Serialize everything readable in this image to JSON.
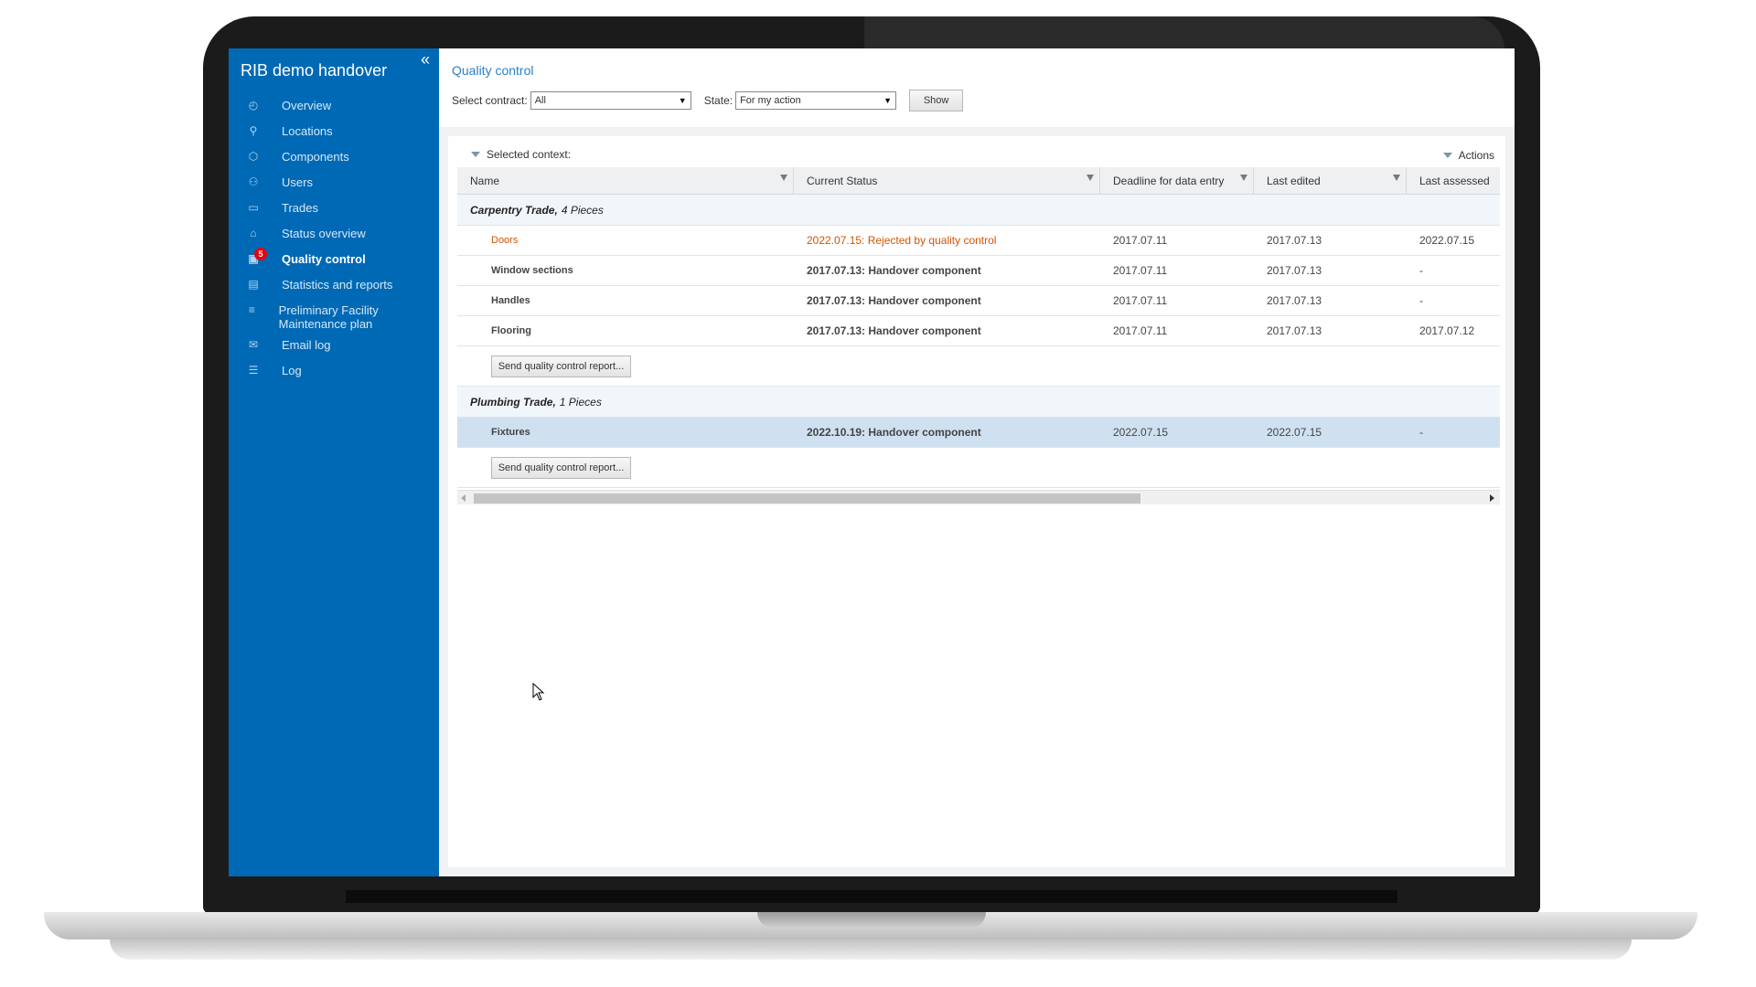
{
  "app": {
    "title": "RIB demo handover",
    "collapse_icon": "«"
  },
  "sidebar": {
    "items": [
      {
        "label": "Overview",
        "icon": "gauge-icon",
        "glyph": "◴"
      },
      {
        "label": "Locations",
        "icon": "location-pin-icon",
        "glyph": "⚲"
      },
      {
        "label": "Components",
        "icon": "cube-icon",
        "glyph": "⬡"
      },
      {
        "label": "Users",
        "icon": "users-icon",
        "glyph": "⚇"
      },
      {
        "label": "Trades",
        "icon": "briefcase-icon",
        "glyph": "▭"
      },
      {
        "label": "Status overview",
        "icon": "tag-icon",
        "glyph": "⌂"
      },
      {
        "label": "Quality control",
        "icon": "clipboard-icon",
        "glyph": "▣",
        "badge": "5",
        "active": true
      },
      {
        "label": "Statistics and reports",
        "icon": "document-icon",
        "glyph": "▤"
      },
      {
        "label": "Preliminary Facility Maintenance plan",
        "icon": "bar-chart-icon",
        "glyph": "≡"
      },
      {
        "label": "Email log",
        "icon": "envelope-icon",
        "glyph": "✉"
      },
      {
        "label": "Log",
        "icon": "list-icon",
        "glyph": "☰"
      }
    ]
  },
  "main": {
    "page_title": "Quality control",
    "filters": {
      "contract_label": "Select contract:",
      "contract_value": "All",
      "state_label": "State:",
      "state_value": "For my action",
      "show_button": "Show"
    },
    "context_label": "Selected context:",
    "actions_label": "Actions",
    "columns": [
      "Name",
      "Current Status",
      "Deadline for data entry",
      "Last edited",
      "Last assessed"
    ],
    "groups": [
      {
        "name": "Carpentry Trade,",
        "count": "4 Pieces",
        "rows": [
          {
            "name": "Doors",
            "status": "2022.07.15: Rejected by quality control",
            "deadline": "2017.07.11",
            "edited": "2017.07.13",
            "assessed": "2022.07.15",
            "rejected": true
          },
          {
            "name": "Window sections",
            "status": "2017.07.13: Handover component",
            "deadline": "2017.07.11",
            "edited": "2017.07.13",
            "assessed": "-"
          },
          {
            "name": "Handles",
            "status": "2017.07.13: Handover component",
            "deadline": "2017.07.11",
            "edited": "2017.07.13",
            "assessed": "-"
          },
          {
            "name": "Flooring",
            "status": "2017.07.13: Handover component",
            "deadline": "2017.07.11",
            "edited": "2017.07.13",
            "assessed": "2017.07.12"
          }
        ],
        "report_button": "Send quality control report..."
      },
      {
        "name": "Plumbing Trade,",
        "count": "1 Pieces",
        "rows": [
          {
            "name": "Fixtures",
            "status": "2022.10.19: Handover component",
            "deadline": "2022.07.15",
            "edited": "2022.07.15",
            "assessed": "-",
            "selected": true
          }
        ],
        "report_button": "Send quality control report..."
      }
    ],
    "scroll": {
      "position_fraction": 0.0,
      "visible_fraction": 0.66
    }
  }
}
